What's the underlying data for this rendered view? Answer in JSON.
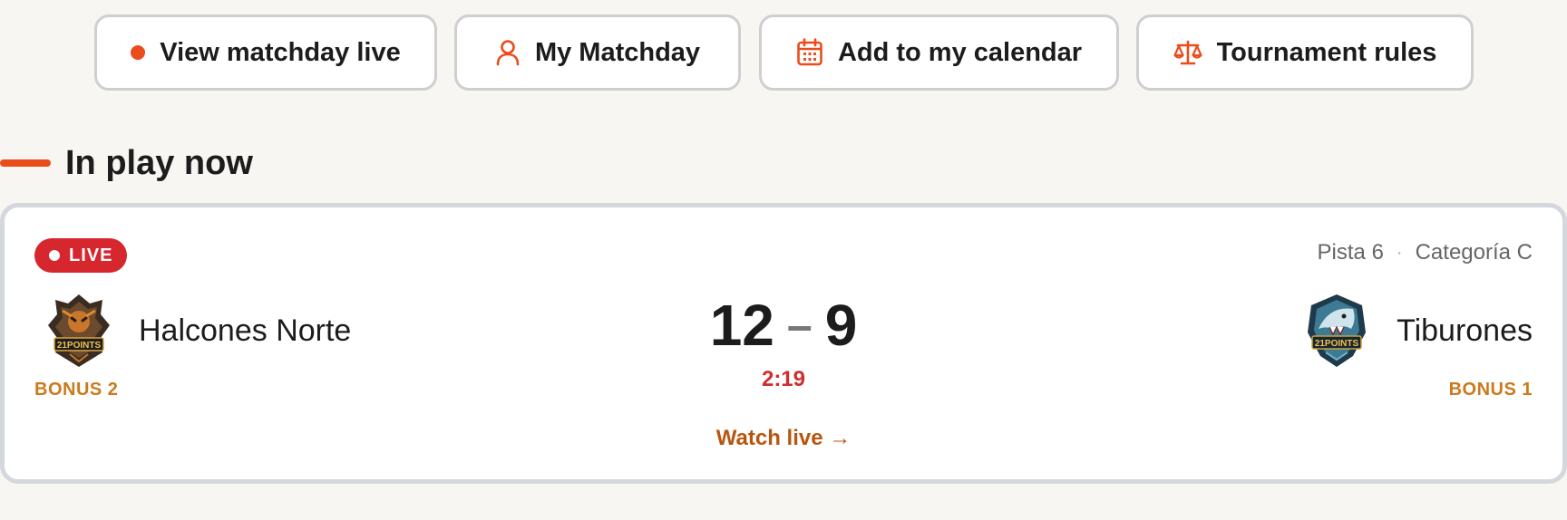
{
  "actions": {
    "view_live": "View matchday live",
    "my_matchday": "My Matchday",
    "calendar": "Add to my calendar",
    "rules": "Tournament rules"
  },
  "section": {
    "title": "In play now"
  },
  "match": {
    "status": "LIVE",
    "court": "Pista 6",
    "separator": "·",
    "category": "Categoría C",
    "home": {
      "name": "Halcones Norte",
      "bonus": "BONUS 2",
      "logo": "21POINTS",
      "score": "12"
    },
    "away": {
      "name": "Tiburones",
      "bonus": "BONUS 1",
      "logo": "21POINTS",
      "score": "9"
    },
    "score_dash": "–",
    "clock": "2:19",
    "watch_label": "Watch live →"
  },
  "colors": {
    "accent": "#ea4c1c",
    "live": "#d6262e",
    "bonus": "#cc7a1b",
    "watch": "#b8560f"
  },
  "icons": [
    "live-dot-icon",
    "user-icon",
    "calendar-icon",
    "scales-icon"
  ]
}
